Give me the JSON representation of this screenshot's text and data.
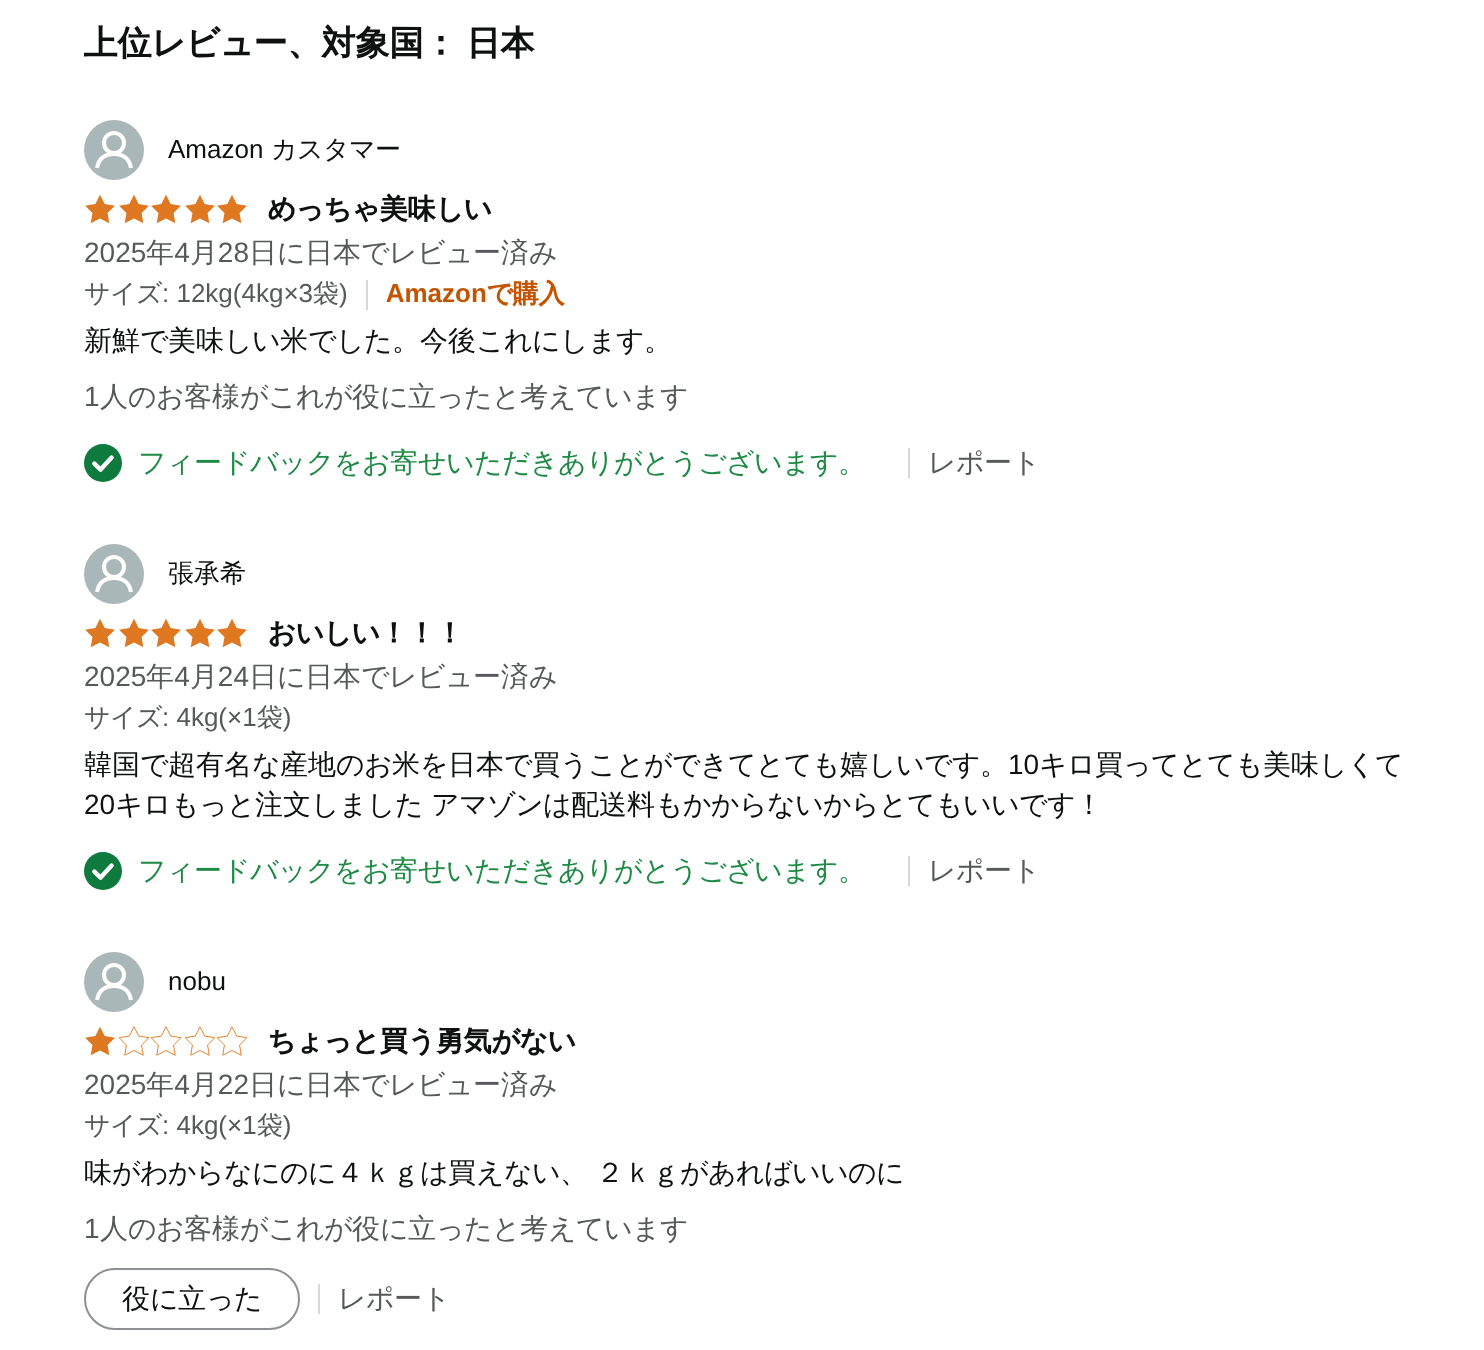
{
  "heading": "上位レビュー、対象国： 日本",
  "reviews": [
    {
      "author": "Amazon カスタマー",
      "stars": 5,
      "title": "めっちゃ美味しい",
      "date": "2025年4月28日に日本でレビュー済み",
      "size": "サイズ: 12kg(4kg×3袋)",
      "verified": "Amazonで購入",
      "body": "新鮮で美味しい米でした。今後これにします。",
      "helpful_count": "1人のお客様がこれが役に立ったと考えています",
      "helpful_action": {
        "kind": "thanks",
        "text": "フィードバックをお寄せいただきありがとうございます。"
      },
      "report": "レポート"
    },
    {
      "author": "張承希",
      "stars": 5,
      "title": "おいしい！！！",
      "date": "2025年4月24日に日本でレビュー済み",
      "size": "サイズ: 4kg(×1袋)",
      "body": "韓国で超有名な産地のお米を日本で買うことができてとても嬉しいです。10キロ買ってとても美味しくて20キロもっと注文しました アマゾンは配送料もかからないからとてもいいです！",
      "helpful_action": {
        "kind": "thanks",
        "text": "フィードバックをお寄せいただきありがとうございます。"
      },
      "report": "レポート"
    },
    {
      "author": "nobu",
      "stars": 1,
      "title": "ちょっと買う勇気がない",
      "date": "2025年4月22日に日本でレビュー済み",
      "size": "サイズ: 4kg(×1袋)",
      "body": "味がわからなにのに４ｋｇは買えない、 ２ｋｇがあればいいのに",
      "helpful_count": "1人のお客様がこれが役に立ったと考えています",
      "helpful_action": {
        "kind": "button",
        "text": "役に立った"
      },
      "report": "レポート"
    }
  ]
}
